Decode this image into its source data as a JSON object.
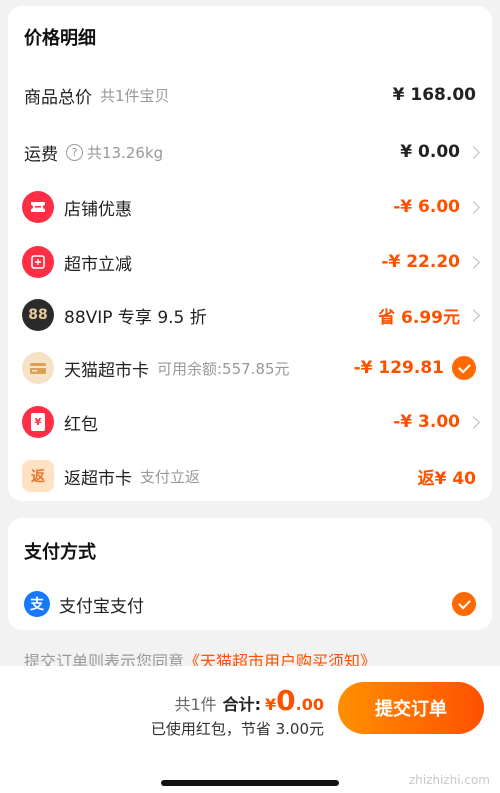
{
  "price_section": {
    "title": "价格明细",
    "rows": [
      {
        "label": "商品总价",
        "sub": "共1件宝贝",
        "value": "¥ 168.00"
      },
      {
        "label": "运费",
        "sub": "共13.26kg",
        "value": "¥ 0.00"
      },
      {
        "label": "店铺优惠",
        "value": "-¥ 6.00",
        "icon": "ticket-icon",
        "icon_color": "#ff2e44"
      },
      {
        "label": "超市立减",
        "value": "-¥ 22.20",
        "icon": "discount-badge-icon",
        "icon_color": "#ff2e44"
      },
      {
        "label": "88VIP 专享 9.5 折",
        "value": "省 6.99元",
        "icon": "88vip-icon",
        "icon_color": "#2b2b2b",
        "icon_text": "88"
      },
      {
        "label": "天猫超市卡",
        "sub": "可用余额:557.85元",
        "value": "-¥ 129.81",
        "icon": "card-icon",
        "icon_color": "#f6e2c6",
        "checked": true
      },
      {
        "label": "红包",
        "value": "-¥ 3.00",
        "icon": "red-envelope-icon",
        "icon_color": "#ff2e44",
        "icon_text": "¥"
      },
      {
        "label": "返超市卡",
        "sub": "支付立返",
        "value": "返¥ 40",
        "icon": "cashback-icon",
        "icon_color": "#ffe2c2",
        "icon_text": "返"
      }
    ]
  },
  "payment_section": {
    "title": "支付方式",
    "method": {
      "label": "支付宝支付",
      "icon": "alipay-icon",
      "icon_text": "支",
      "icon_color": "#1677ff",
      "checked": true
    }
  },
  "agreement": {
    "prefix": "提交订单则表示您同意",
    "link": "《天猫超市用户购买须知》"
  },
  "bottom_bar": {
    "count": "共1件",
    "total_label": "合计:",
    "currency": "¥",
    "amount_int": "0",
    "amount_dec": ".00",
    "saved_text": "已使用红包，节省 3.00元",
    "submit_label": "提交订单",
    "watermark": "zhizhizhi.com"
  },
  "colors": {
    "accent": "#ff5000",
    "button_gradient_start": "#ff9000",
    "button_gradient_end": "#ff5000"
  }
}
